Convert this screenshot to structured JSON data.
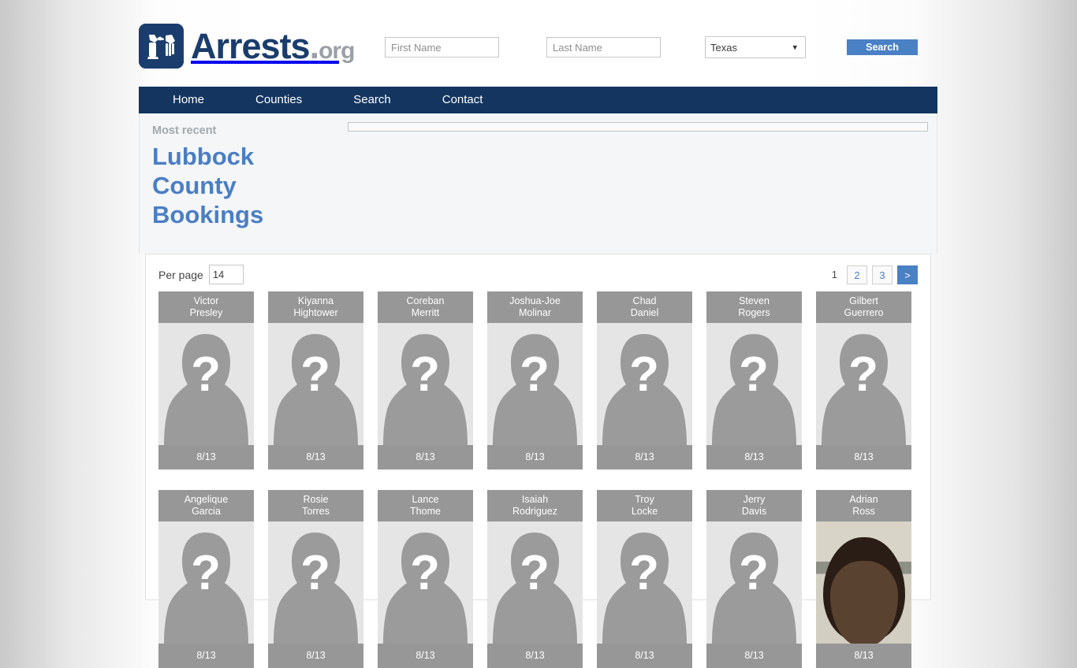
{
  "site": {
    "brand_main": "Arrests",
    "brand_dot": ".",
    "brand_org": "org",
    "logo_icon": "handcuffed-hands-icon"
  },
  "search": {
    "first_name_placeholder": "First Name",
    "first_name_value": "",
    "last_name_placeholder": "Last Name",
    "last_name_value": "",
    "state_selected": "Texas",
    "state_options": [
      "Texas"
    ],
    "submit_label": "Search",
    "chevron_icon": "chevron-down-icon"
  },
  "nav": {
    "items": [
      {
        "label": "Home"
      },
      {
        "label": "Counties"
      },
      {
        "label": "Search"
      },
      {
        "label": "Contact"
      }
    ]
  },
  "hero": {
    "eyebrow": "Most recent",
    "title": "Lubbock County Bookings",
    "title_color": "#4a7ec4"
  },
  "results": {
    "per_page_label": "Per page",
    "per_page_selected": "14",
    "per_page_options": [
      "14"
    ],
    "pagination": {
      "current": "1",
      "pages": [
        "2",
        "3"
      ],
      "next_label": ">"
    },
    "cards": [
      {
        "first": "Victor",
        "last": "Presley",
        "date": "8/13",
        "photo": "placeholder"
      },
      {
        "first": "Kiyanna",
        "last": "Hightower",
        "date": "8/13",
        "photo": "placeholder"
      },
      {
        "first": "Coreban",
        "last": "Merritt",
        "date": "8/13",
        "photo": "placeholder"
      },
      {
        "first": "Joshua-Joe",
        "last": "Molinar",
        "date": "8/13",
        "photo": "placeholder"
      },
      {
        "first": "Chad",
        "last": "Daniel",
        "date": "8/13",
        "photo": "placeholder"
      },
      {
        "first": "Steven",
        "last": "Rogers",
        "date": "8/13",
        "photo": "placeholder"
      },
      {
        "first": "Gilbert",
        "last": "Guerrero",
        "date": "8/13",
        "photo": "placeholder"
      },
      {
        "first": "Angelique",
        "last": "Garcia",
        "date": "8/13",
        "photo": "placeholder"
      },
      {
        "first": "Rosie",
        "last": "Torres",
        "date": "8/13",
        "photo": "placeholder"
      },
      {
        "first": "Lance",
        "last": "Thome",
        "date": "8/13",
        "photo": "placeholder"
      },
      {
        "first": "Isaiah",
        "last": "Rodriguez",
        "date": "8/13",
        "photo": "placeholder"
      },
      {
        "first": "Troy",
        "last": "Locke",
        "date": "8/13",
        "photo": "placeholder"
      },
      {
        "first": "Jerry",
        "last": "Davis",
        "date": "8/13",
        "photo": "placeholder"
      },
      {
        "first": "Adrian",
        "last": "Ross",
        "date": "8/13",
        "photo": "mugshot"
      }
    ]
  }
}
